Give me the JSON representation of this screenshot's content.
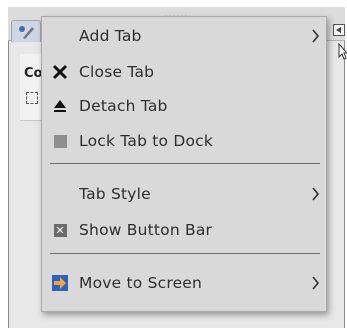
{
  "background": {
    "panel_heading": "Co",
    "panel_color": "#e8e8e8"
  },
  "menu": {
    "items": [
      {
        "id": "add-tab",
        "label": "Add Tab",
        "icon": "none",
        "submenu": true
      },
      {
        "id": "close-tab",
        "label": "Close Tab",
        "icon": "close-x-icon",
        "submenu": false
      },
      {
        "id": "detach-tab",
        "label": "Detach Tab",
        "icon": "eject-icon",
        "submenu": false
      },
      {
        "id": "lock-tab",
        "label": "Lock Tab to Dock",
        "icon": "stop-square-icon",
        "submenu": false
      },
      {
        "id": "tab-style",
        "label": "Tab Style",
        "icon": "none",
        "submenu": true
      },
      {
        "id": "show-button-bar",
        "label": "Show Button Bar",
        "icon": "checkbox-checked-icon",
        "submenu": false
      },
      {
        "id": "move-to-screen",
        "label": "Move to Screen",
        "icon": "arrow-right-orange-icon",
        "submenu": true
      }
    ],
    "colors": {
      "background": "#d9d9d9",
      "text": "#2e2e2e",
      "separator": "#6e6e6e",
      "move_icon_bg": "#2a62c8",
      "move_icon_arrow": "#f5a623"
    }
  }
}
